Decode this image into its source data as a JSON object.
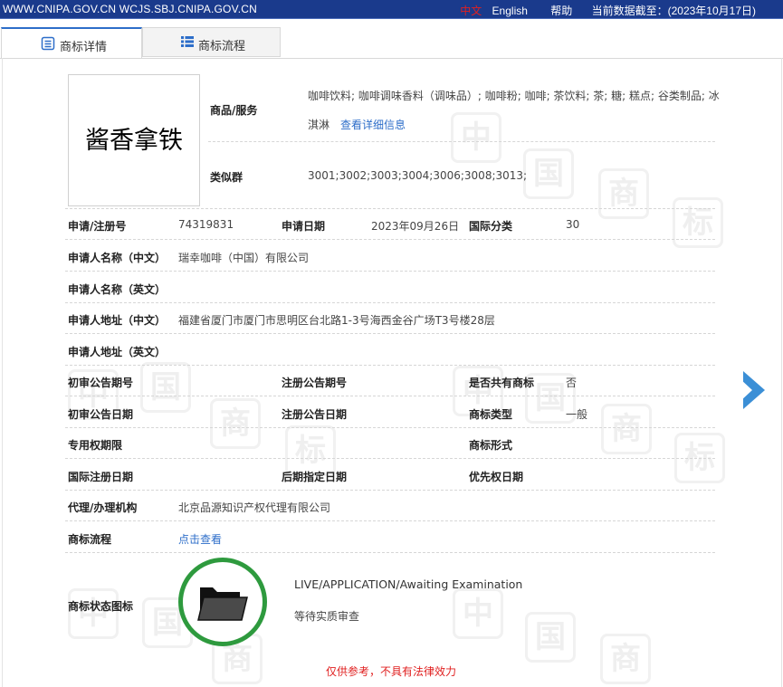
{
  "topbar": {
    "sites": "WWW.CNIPA.GOV.CN WCJS.SBJ.CNIPA.GOV.CN",
    "lang_cn": "中文",
    "lang_en": "English",
    "help": "帮助",
    "data_as_of": "当前数据截至：(2023年10月17日)"
  },
  "tabs": [
    {
      "label": "商标详情",
      "icon": "document-icon",
      "active": true
    },
    {
      "label": "商标流程",
      "icon": "list-icon",
      "active": false
    }
  ],
  "trademark": {
    "name_image_text": "酱香拿铁",
    "goods_label": "商品/服务",
    "goods_value_line1": "咖啡饮料; 咖啡调味香料（调味品）; 咖啡粉; 咖啡; 茶饮料; 茶; 糖; 糕点; 谷类制品; 冰",
    "goods_value_line2": "淇淋",
    "goods_more_link": "查看详细信息",
    "similar_group_label": "类似群",
    "similar_group_value": "3001;3002;3003;3004;3006;3008;3013;",
    "reg_no_label": "申请/注册号",
    "reg_no_value": "74319831",
    "apply_date_label": "申请日期",
    "apply_date_value": "2023年09月26日",
    "intl_class_label": "国际分类",
    "intl_class_value": "30",
    "applicant_cn_label": "申请人名称（中文）",
    "applicant_cn_value": "瑞幸咖啡（中国）有限公司",
    "applicant_en_label": "申请人名称（英文）",
    "address_cn_label": "申请人地址（中文）",
    "address_cn_value": "福建省厦门市厦门市思明区台北路1-3号海西金谷广场T3号楼28层",
    "address_en_label": "申请人地址（英文）",
    "prelim_pub_no_label": "初审公告期号",
    "reg_pub_no_label": "注册公告期号",
    "shared_label": "是否共有商标",
    "shared_value": "否",
    "prelim_pub_date_label": "初审公告日期",
    "reg_pub_date_label": "注册公告日期",
    "tm_type_label": "商标类型",
    "tm_type_value": "一般",
    "exclusive_period_label": "专用权期限",
    "tm_form_label": "商标形式",
    "intl_reg_date_label": "国际注册日期",
    "later_designation_label": "后期指定日期",
    "priority_date_label": "优先权日期",
    "agent_label": "代理/办理机构",
    "agent_value": "北京品源知识产权代理有限公司",
    "process_label": "商标流程",
    "process_link": "点击查看",
    "status_icon_label": "商标状态图标",
    "status_en": "LIVE/APPLICATION/Awaiting Examination",
    "status_cn": "等待实质审查"
  },
  "disclaimer": "仅供参考，不具有法律效力",
  "watermark_chars": [
    "中",
    "国",
    "商",
    "标"
  ],
  "colors": {
    "topbar_bg": "#1a3a8c",
    "link": "#2d6ec9",
    "status_ring": "#2e9a3e",
    "disclaimer": "#e02020",
    "arrow": "#3b8fd6"
  }
}
